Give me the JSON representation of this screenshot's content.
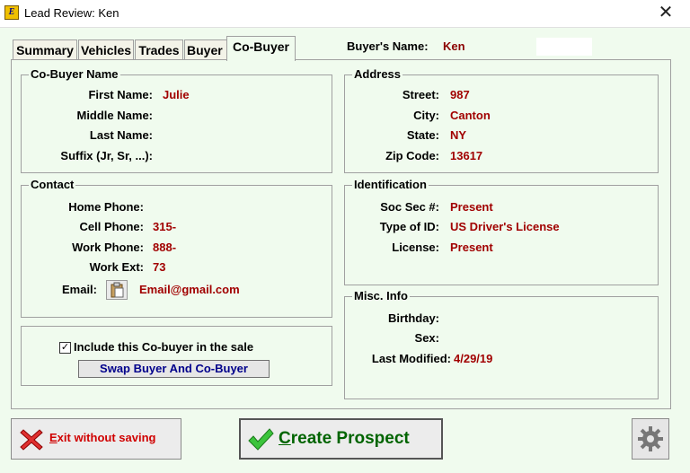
{
  "window": {
    "title": "Lead Review: Ken",
    "app_icon_text": "E"
  },
  "tabs": [
    {
      "label": "Summary"
    },
    {
      "label": "Vehicles"
    },
    {
      "label": "Trades"
    },
    {
      "label": "Buyer"
    },
    {
      "label": "Co-Buyer",
      "active": true
    }
  ],
  "header": {
    "buyer_name_label": "Buyer's Name:",
    "buyer_name_value": "Ken"
  },
  "cobuyer_name": {
    "title": "Co-Buyer Name",
    "first_name_label": "First Name:",
    "first_name_value": "Julie",
    "middle_name_label": "Middle Name:",
    "middle_name_value": "",
    "last_name_label": "Last Name:",
    "last_name_value": "",
    "suffix_label": "Suffix (Jr, Sr, ...):",
    "suffix_value": ""
  },
  "contact": {
    "title": "Contact",
    "home_phone_label": "Home Phone:",
    "home_phone_value": "",
    "cell_phone_label": "Cell Phone:",
    "cell_phone_value": "315-",
    "work_phone_label": "Work Phone:",
    "work_phone_value": "888-",
    "work_ext_label": "Work Ext:",
    "work_ext_value": "73",
    "email_label": "Email:",
    "email_value": "Email@gmail.com"
  },
  "include": {
    "checkbox_label": "Include this Co-buyer in the sale",
    "checked": true,
    "swap_label": "Swap Buyer And Co-Buyer"
  },
  "address": {
    "title": "Address",
    "street_label": "Street:",
    "street_value": "987",
    "city_label": "City:",
    "city_value": "Canton",
    "state_label": "State:",
    "state_value": "NY",
    "zip_label": "Zip Code:",
    "zip_value": "13617"
  },
  "identification": {
    "title": "Identification",
    "ssn_label": "Soc Sec #:",
    "ssn_value": "Present",
    "id_type_label": "Type of ID:",
    "id_type_value": "US Driver's License",
    "license_label": "License:",
    "license_value": "Present"
  },
  "misc": {
    "title": "Misc. Info",
    "birthday_label": "Birthday:",
    "birthday_value": "",
    "sex_label": "Sex:",
    "sex_value": "",
    "modified_label": "Last Modified:",
    "modified_value": "4/29/19"
  },
  "footer": {
    "exit_label": "Exit without saving",
    "create_label": "Create Prospect"
  },
  "colors": {
    "value_red": "#a10000",
    "exit_red": "#d00000",
    "create_green": "#006400",
    "background": "#f0fbee"
  }
}
